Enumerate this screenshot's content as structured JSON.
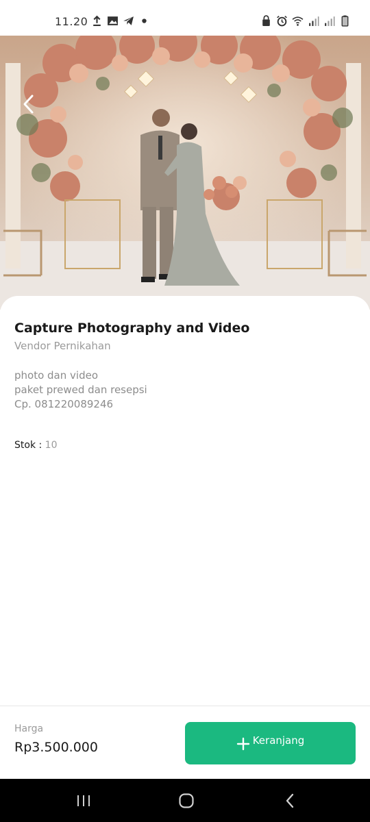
{
  "status_bar": {
    "time": "11.20",
    "left_icons": [
      "upload-icon",
      "image-icon",
      "telegram-icon",
      "dot-icon"
    ],
    "right_icons": [
      "lock-icon",
      "alarm-icon",
      "wifi-icon",
      "signal-icon",
      "signal-icon",
      "battery-icon"
    ]
  },
  "hero": {
    "image": "wedding-photo",
    "back_icon": "chevron-left-icon"
  },
  "product": {
    "title": "Capture Photography and Video",
    "category": "Vendor Pernikahan",
    "description": [
      "photo dan video",
      "paket prewed dan resepsi",
      "Cp. 081220089246"
    ],
    "stock_label": "Stok :",
    "stock_value": "10"
  },
  "bottom": {
    "price_label": "Harga",
    "price_value": "Rp3.500.000",
    "cart_button_label": "Keranjang",
    "cart_button_icon": "plus-icon",
    "accent_color": "#1bb980"
  },
  "nav": {
    "icons": [
      "recent-apps-icon",
      "home-icon",
      "back-icon"
    ]
  }
}
